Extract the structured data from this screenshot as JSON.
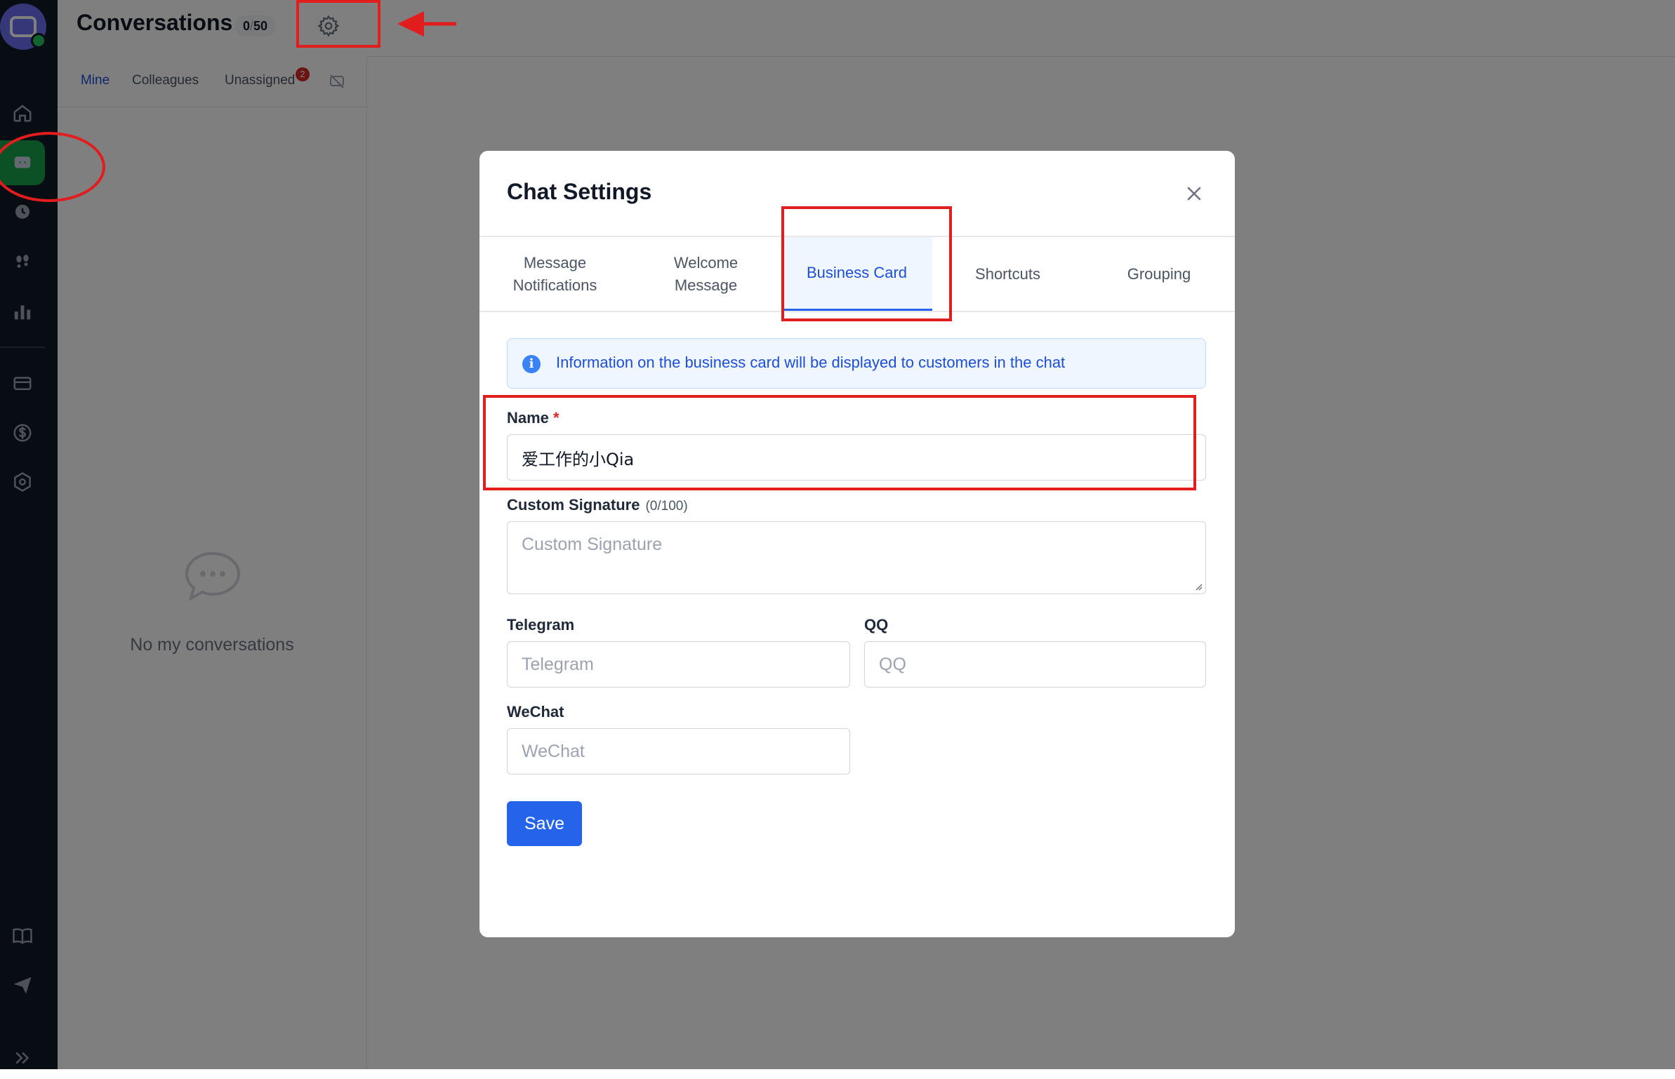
{
  "header": {
    "title": "Conversations",
    "count_current": "0",
    "count_max": "50"
  },
  "conversation_list": {
    "tabs": [
      "Mine",
      "Colleagues",
      "Unassigned"
    ],
    "active_tab": "Mine",
    "unassigned_badge": "2",
    "empty_text": "No my conversations"
  },
  "modal": {
    "title": "Chat Settings",
    "tabs": [
      {
        "label": "Message Notifications"
      },
      {
        "label": "Welcome Message"
      },
      {
        "label": "Business Card"
      },
      {
        "label": "Shortcuts"
      },
      {
        "label": "Grouping"
      }
    ],
    "active_tab": "Business Card",
    "info_text": "Information on the business card will be displayed to customers in the chat",
    "fields": {
      "name_label": "Name",
      "name_required_mark": "*",
      "name_value": "爱工作的小Qia",
      "signature_label": "Custom Signature",
      "signature_count": "(0/100)",
      "signature_placeholder": "Custom Signature",
      "telegram_label": "Telegram",
      "telegram_placeholder": "Telegram",
      "qq_label": "QQ",
      "qq_placeholder": "QQ",
      "wechat_label": "WeChat",
      "wechat_placeholder": "WeChat"
    },
    "save_label": "Save"
  },
  "colors": {
    "accent": "#2563eb",
    "active_nav": "#16a34a",
    "rail": "#111827",
    "annotation": "#e11d1d"
  },
  "icons": {
    "rail": [
      "home-icon",
      "chat-icon",
      "history-icon",
      "visitors-icon",
      "stats-icon",
      "card-icon",
      "billing-icon",
      "settings-hex-icon",
      "book-icon",
      "send-icon",
      "expand-icon"
    ]
  }
}
